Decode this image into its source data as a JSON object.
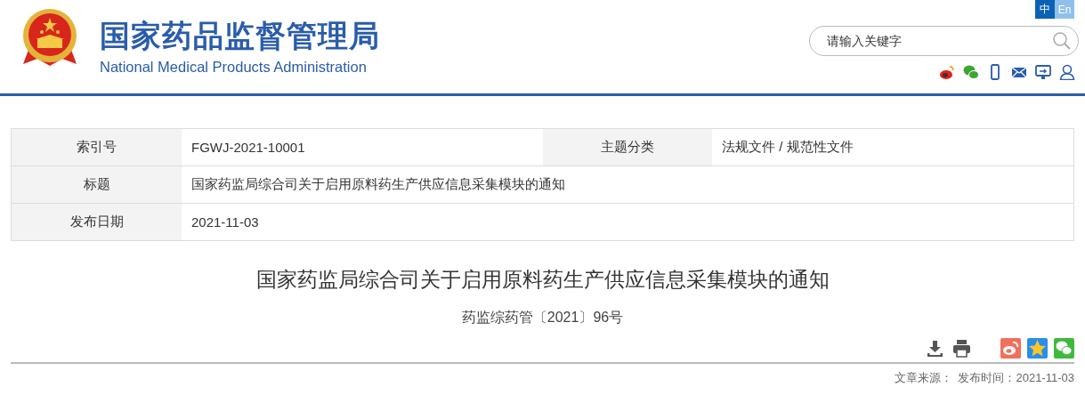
{
  "header": {
    "title_zh": "国家药品监督管理局",
    "title_en": "National Medical Products Administration",
    "languages": [
      {
        "label": "中",
        "selected": true
      },
      {
        "label": "En",
        "selected": false
      }
    ],
    "search": {
      "placeholder": "请输入关键字"
    }
  },
  "info_table": {
    "rows": [
      [
        {
          "label": "索引号",
          "value": "FGWJ-2021-10001"
        },
        {
          "label": "主题分类",
          "value": "法规文件 / 规范性文件"
        }
      ],
      [
        {
          "label": "标题",
          "value": "国家药监局综合司关于启用原料药生产供应信息采集模块的通知"
        }
      ],
      [
        {
          "label": "发布日期",
          "value": "2021-11-03"
        }
      ]
    ]
  },
  "article": {
    "title": "国家药监局综合司关于启用原料药生产供应信息采集模块的通知",
    "doc_number": "药监综药管〔2021〕96号",
    "source_label": "文章来源：",
    "publish_label": "发布时间：2021-11-03"
  }
}
